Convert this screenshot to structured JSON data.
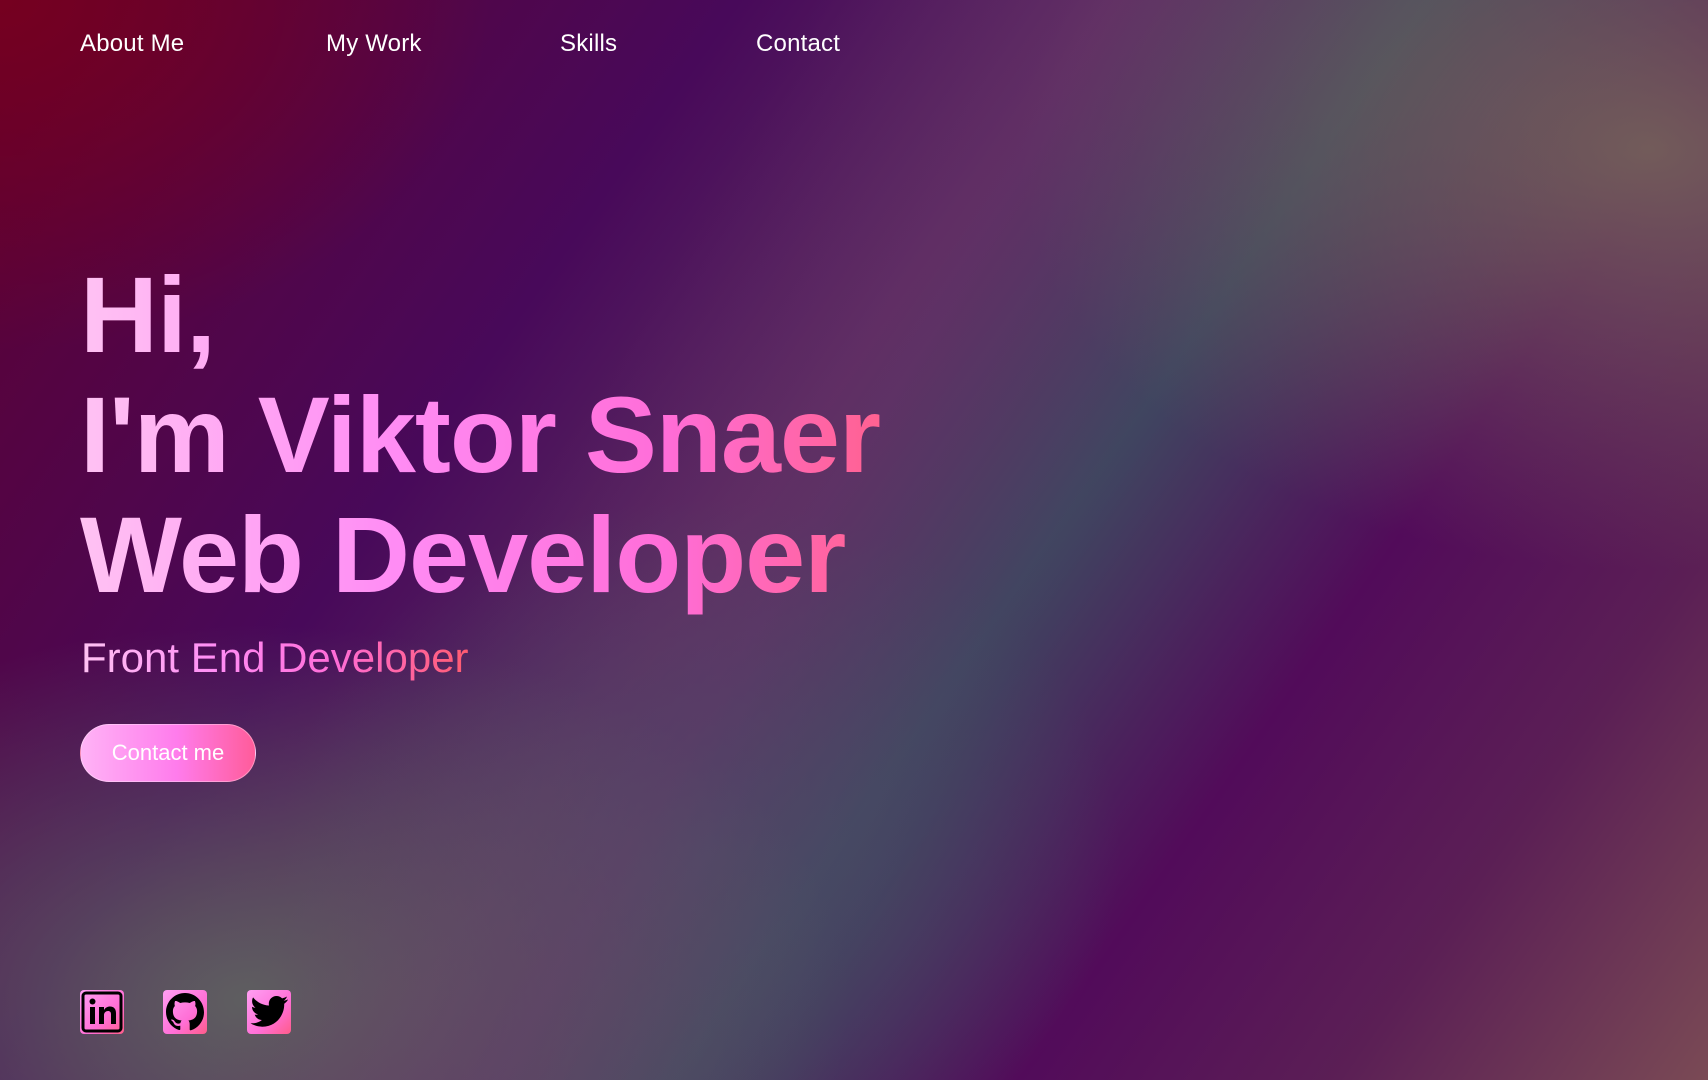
{
  "nav": {
    "items": [
      {
        "label": "About Me"
      },
      {
        "label": "My Work"
      },
      {
        "label": "Skills"
      },
      {
        "label": "Contact"
      }
    ]
  },
  "hero": {
    "line1": "Hi,",
    "line2": "I'm Viktor Snaer",
    "line3": "Web Developer",
    "subtitle": "Front End Developer",
    "cta_label": "Contact me"
  },
  "socials": [
    {
      "icon": "linkedin-icon"
    },
    {
      "icon": "github-icon"
    },
    {
      "icon": "twitter-icon"
    }
  ],
  "colors": {
    "accent_light": "#ffc2f3",
    "accent_pink": "#ff8cf4",
    "accent_coral": "#ff5c70"
  }
}
